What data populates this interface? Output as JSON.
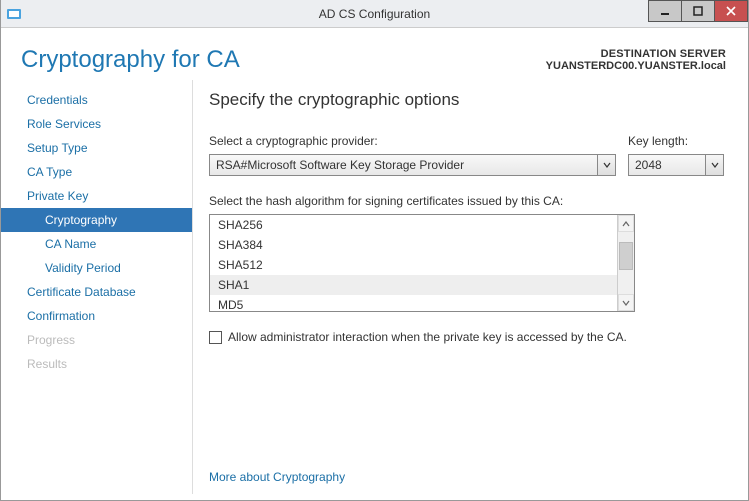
{
  "window": {
    "title": "AD CS Configuration"
  },
  "page": {
    "title": "Cryptography for CA",
    "destination_label": "DESTINATION SERVER",
    "destination_name": "YUANSTERDC00.YUANSTER.local"
  },
  "sidebar": {
    "items": [
      {
        "label": "Credentials",
        "indent": false,
        "selected": false,
        "disabled": false
      },
      {
        "label": "Role Services",
        "indent": false,
        "selected": false,
        "disabled": false
      },
      {
        "label": "Setup Type",
        "indent": false,
        "selected": false,
        "disabled": false
      },
      {
        "label": "CA Type",
        "indent": false,
        "selected": false,
        "disabled": false
      },
      {
        "label": "Private Key",
        "indent": false,
        "selected": false,
        "disabled": false
      },
      {
        "label": "Cryptography",
        "indent": true,
        "selected": true,
        "disabled": false
      },
      {
        "label": "CA Name",
        "indent": true,
        "selected": false,
        "disabled": false
      },
      {
        "label": "Validity Period",
        "indent": true,
        "selected": false,
        "disabled": false
      },
      {
        "label": "Certificate Database",
        "indent": false,
        "selected": false,
        "disabled": false
      },
      {
        "label": "Confirmation",
        "indent": false,
        "selected": false,
        "disabled": false
      },
      {
        "label": "Progress",
        "indent": false,
        "selected": false,
        "disabled": true
      },
      {
        "label": "Results",
        "indent": false,
        "selected": false,
        "disabled": true
      }
    ]
  },
  "content": {
    "heading": "Specify the cryptographic options",
    "provider_label": "Select a cryptographic provider:",
    "provider_value": "RSA#Microsoft Software Key Storage Provider",
    "keylen_label": "Key length:",
    "keylen_value": "2048",
    "hash_label": "Select the hash algorithm for signing certificates issued by this CA:",
    "hash_options": [
      {
        "name": "SHA256",
        "selected": false
      },
      {
        "name": "SHA384",
        "selected": false
      },
      {
        "name": "SHA512",
        "selected": false
      },
      {
        "name": "SHA1",
        "selected": true
      },
      {
        "name": "MD5",
        "selected": false
      }
    ],
    "checkbox_label": "Allow administrator interaction when the private key is accessed by the CA.",
    "checkbox_checked": false,
    "more_link": "More about Cryptography"
  }
}
